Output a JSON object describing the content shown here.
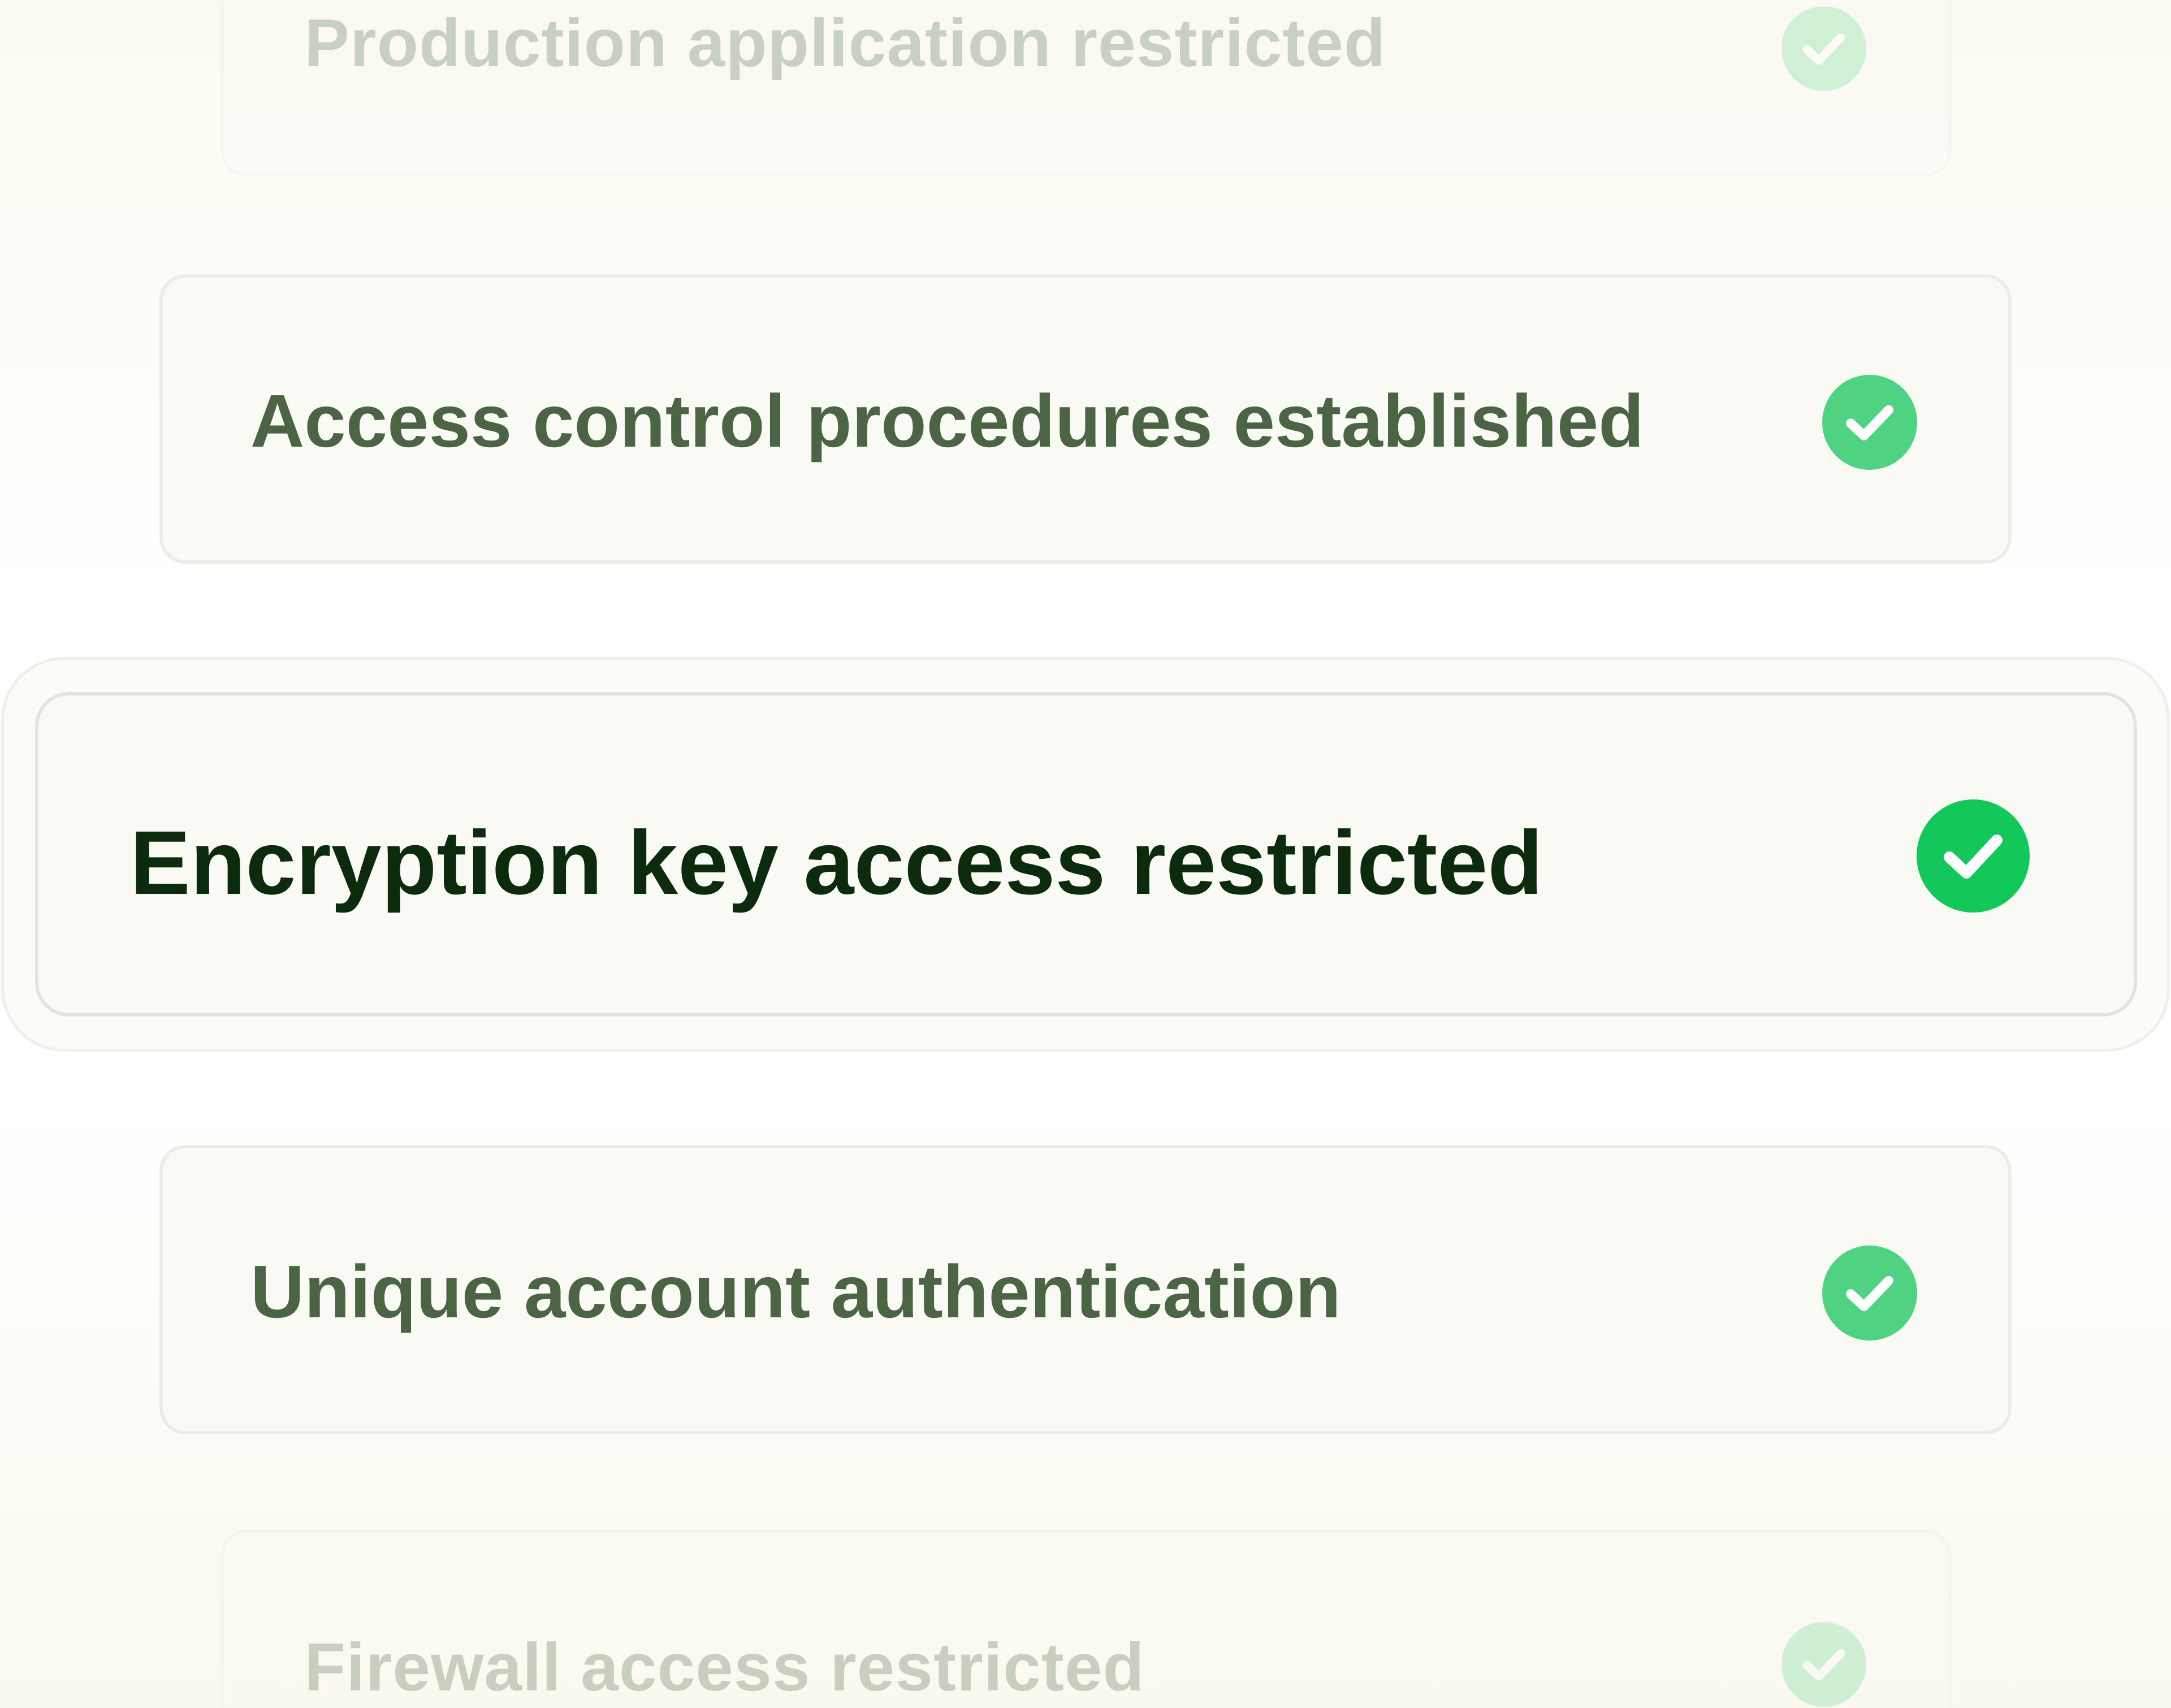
{
  "checklist": {
    "items": [
      {
        "label": "Production application restricted",
        "status_icon": "check-circle-icon",
        "state": "faded"
      },
      {
        "label": "Access control procedures established",
        "status_icon": "check-circle-icon",
        "state": "default"
      },
      {
        "label": "Encryption key access restricted",
        "status_icon": "check-circle-icon",
        "state": "highlighted"
      },
      {
        "label": "Unique account authentication",
        "status_icon": "check-circle-icon",
        "state": "default"
      },
      {
        "label": "Firewall access restricted",
        "status_icon": "check-circle-icon",
        "state": "faded"
      }
    ]
  },
  "colors": {
    "check_green": "#13c75a",
    "check_green_muted": "#4fd383",
    "label_dark": "#0c2a0c",
    "label_muted": "#4b6444",
    "card_background": "#fafaf5",
    "card_border": "#ececea"
  }
}
